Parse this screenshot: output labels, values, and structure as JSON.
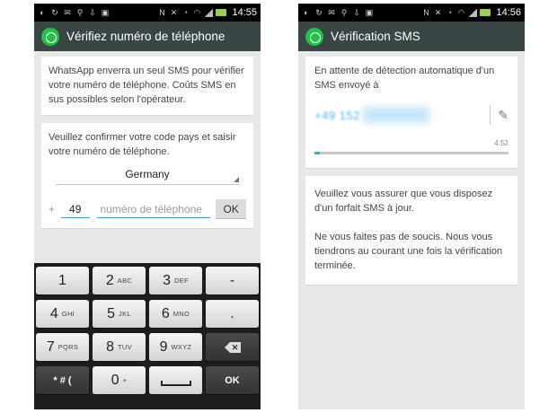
{
  "left": {
    "status": {
      "time": "14:55"
    },
    "title": "Vérifiez numéro de téléphone",
    "info_text": "WhatsApp enverra un seul SMS pour vérifier votre numéro de téléphone. Coûts SMS en sus possibles selon l'opérateur.",
    "confirm_text": "Veuillez confirmer votre code pays et saisir votre numéro de téléphone.",
    "country": "Germany",
    "plus": "+",
    "country_code": "49",
    "phone_placeholder": "numéro de téléphone",
    "ok_label": "OK",
    "keyboard": {
      "rows": [
        [
          {
            "main": "1",
            "sub": ""
          },
          {
            "main": "2",
            "sub": "ABC"
          },
          {
            "main": "3",
            "sub": "DEF"
          },
          {
            "main": "-",
            "sub": ""
          }
        ],
        [
          {
            "main": "4",
            "sub": "GHI"
          },
          {
            "main": "5",
            "sub": "JKL"
          },
          {
            "main": "6",
            "sub": "MNO"
          },
          {
            "main": ".",
            "sub": ""
          }
        ],
        [
          {
            "main": "7",
            "sub": "PQRS"
          },
          {
            "main": "8",
            "sub": "TUV"
          },
          {
            "main": "9",
            "sub": "WXYZ"
          }
        ]
      ],
      "symbols_label": "* # (",
      "zero_label": "0",
      "zero_sub": "+",
      "ok_label": "OK"
    }
  },
  "right": {
    "status": {
      "time": "14:56"
    },
    "title": "Vérification SMS",
    "waiting_text": "En attente de détection automatique d'un SMS envoyé à",
    "phone_number": "+49 152",
    "timer": "4:52",
    "progress": 0.03,
    "note_1": "Veuillez vous assurer que vous disposez d'un forfait SMS à jour.",
    "note_2": "Ne vous faites pas de soucis. Nous vous tiendrons au courant une fois la vérification terminée."
  },
  "colors": {
    "action_bar": "#3a4645",
    "whatsapp_green": "#25c04a",
    "accent_blue": "#33a9d8"
  },
  "icons": [
    "whatsapp-logo-icon",
    "backspace-icon",
    "pencil-icon",
    "battery-icon",
    "signal-icon"
  ]
}
